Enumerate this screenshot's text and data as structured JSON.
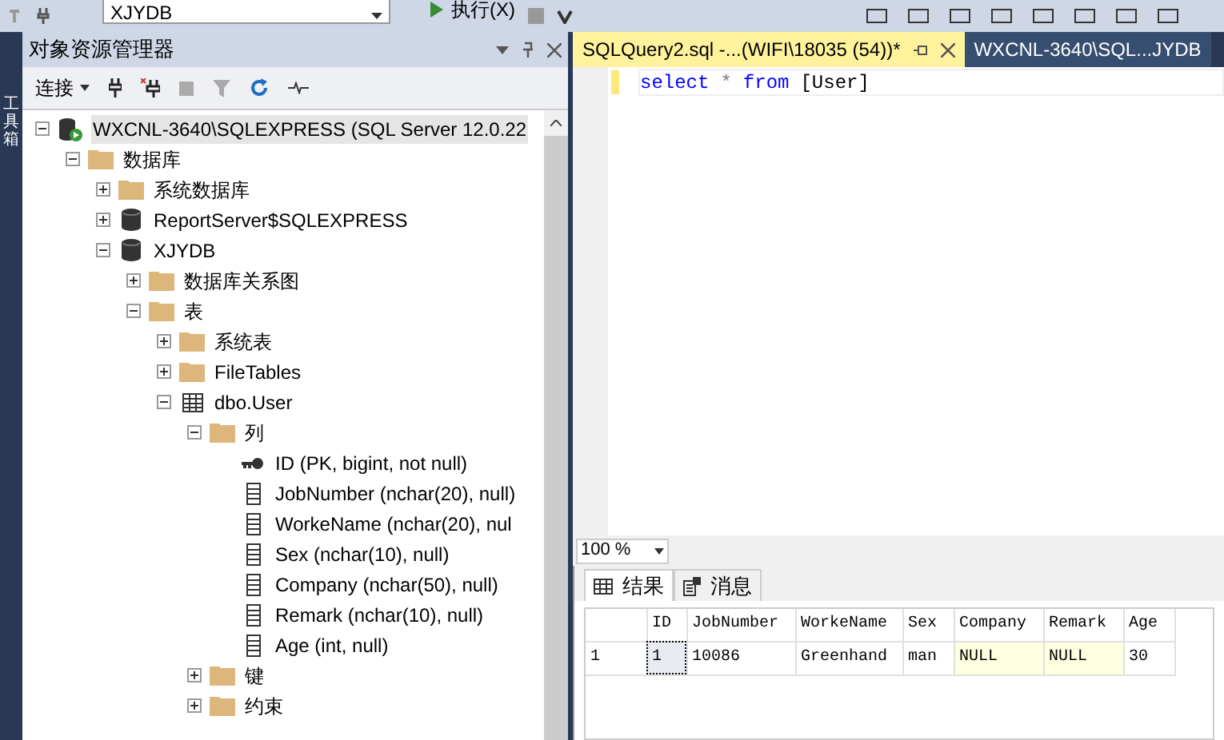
{
  "toolbar": {
    "database": "XJYDB",
    "execute": "执行(X)"
  },
  "toolbox_tab": "工具箱",
  "object_explorer": {
    "title": "对象资源管理器",
    "connect": "连接",
    "tree": [
      {
        "kind": "server",
        "label": "WXCNL-3640\\SQLEXPRESS (SQL Server 12.0.22",
        "expanded": true,
        "selected": true,
        "children": [
          {
            "kind": "folder",
            "label": "数据库",
            "expanded": true,
            "selected": false,
            "children": [
              {
                "kind": "folder",
                "label": "系统数据库",
                "expanded": false,
                "selected": false
              },
              {
                "kind": "database",
                "label": "ReportServer$SQLEXPRESS",
                "expanded": false,
                "selected": false
              },
              {
                "kind": "database",
                "label": "XJYDB",
                "expanded": true,
                "selected": false,
                "children": [
                  {
                    "kind": "folder",
                    "label": "数据库关系图",
                    "expanded": false,
                    "selected": false
                  },
                  {
                    "kind": "folder",
                    "label": "表",
                    "expanded": true,
                    "selected": false,
                    "children": [
                      {
                        "kind": "folder",
                        "label": "系统表",
                        "expanded": false,
                        "selected": false
                      },
                      {
                        "kind": "folder",
                        "label": "FileTables",
                        "expanded": false,
                        "selected": false
                      },
                      {
                        "kind": "table",
                        "label": "dbo.User",
                        "expanded": true,
                        "selected": false,
                        "children": [
                          {
                            "kind": "folder",
                            "label": "列",
                            "expanded": true,
                            "selected": false,
                            "children": [
                              {
                                "kind": "key",
                                "label": "ID (PK, bigint, not null)",
                                "selected": false
                              },
                              {
                                "kind": "column",
                                "label": "JobNumber (nchar(20), null)",
                                "selected": false
                              },
                              {
                                "kind": "column",
                                "label": "WorkeName (nchar(20), nul",
                                "selected": false
                              },
                              {
                                "kind": "column",
                                "label": "Sex (nchar(10), null)",
                                "selected": false
                              },
                              {
                                "kind": "column",
                                "label": "Company (nchar(50), null)",
                                "selected": false
                              },
                              {
                                "kind": "column",
                                "label": "Remark (nchar(10), null)",
                                "selected": false
                              },
                              {
                                "kind": "column",
                                "label": "Age (int, null)",
                                "selected": false
                              }
                            ]
                          },
                          {
                            "kind": "folder",
                            "label": "键",
                            "expanded": false,
                            "selected": false
                          },
                          {
                            "kind": "folder",
                            "label": "约束",
                            "expanded": false,
                            "selected": false
                          }
                        ]
                      }
                    ]
                  }
                ]
              }
            ]
          }
        ]
      }
    ]
  },
  "editor_tabs": [
    {
      "label": "SQLQuery2.sql -...(WIFI\\18035 (54))*",
      "selected": true
    },
    {
      "label": "WXCNL-3640\\SQL...JYDB",
      "selected": false
    }
  ],
  "query": [
    {
      "kind": "keyword",
      "text": "select"
    },
    {
      "kind": "operator",
      "text": "*"
    },
    {
      "kind": "keyword",
      "text": "from"
    },
    {
      "kind": "identifier",
      "text": "[User]"
    }
  ],
  "zoom": "100 %",
  "result_tabs": [
    {
      "label": "结果",
      "kind": "grid",
      "selected": true
    },
    {
      "label": "消息",
      "kind": "messages",
      "selected": false
    }
  ],
  "results": {
    "columns": [
      "ID",
      "JobNumber",
      "WorkeName",
      "Sex",
      "Company",
      "Remark",
      "Age"
    ],
    "rows": [
      {
        "number": "1",
        "cells": [
          {
            "text": "1",
            "null": false,
            "selected": true
          },
          {
            "text": "10086",
            "null": false,
            "selected": false
          },
          {
            "text": "Greenhand",
            "null": false,
            "selected": false
          },
          {
            "text": "man",
            "null": false,
            "selected": false
          },
          {
            "text": "NULL",
            "null": true,
            "selected": false
          },
          {
            "text": "NULL",
            "null": true,
            "selected": false
          },
          {
            "text": "30",
            "null": false,
            "selected": false
          }
        ]
      }
    ]
  }
}
